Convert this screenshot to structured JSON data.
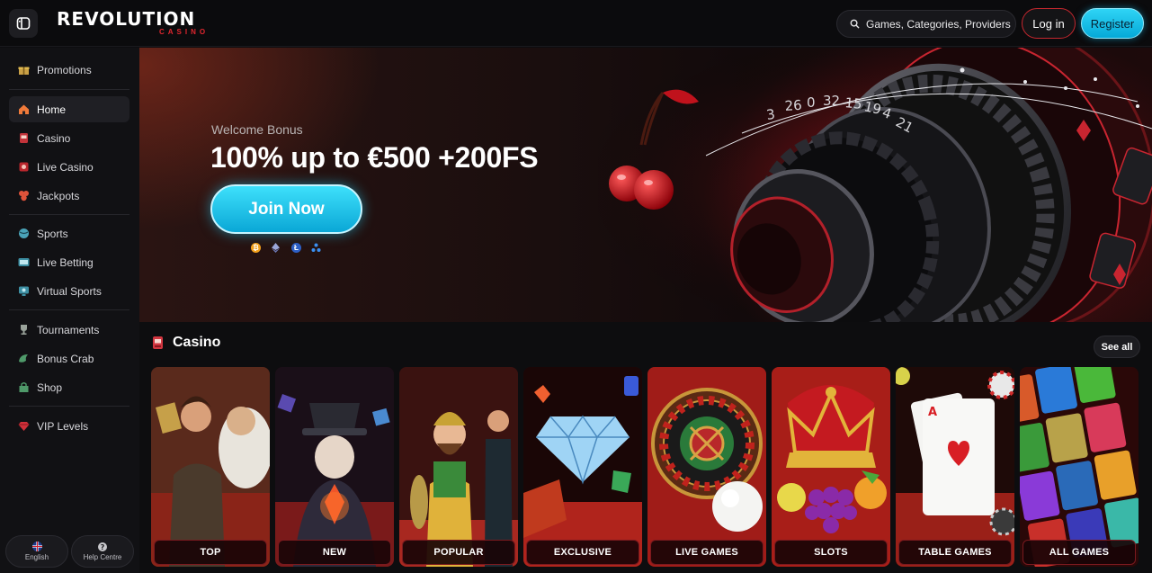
{
  "header": {
    "logo_main": "REVOLUTION",
    "logo_sub": "CASINO",
    "search_placeholder": "Games, Categories, Providers",
    "login_label": "Log in",
    "register_label": "Register"
  },
  "sidebar": {
    "items": [
      {
        "label": "Promotions",
        "icon": "gift-icon"
      },
      {
        "label": "Home",
        "icon": "home-icon"
      },
      {
        "label": "Casino",
        "icon": "slot-machine-icon"
      },
      {
        "label": "Live Casino",
        "icon": "live-casino-icon"
      },
      {
        "label": "Jackpots",
        "icon": "jackpot-icon"
      },
      {
        "label": "Sports",
        "icon": "sports-ball-icon"
      },
      {
        "label": "Live Betting",
        "icon": "live-betting-icon"
      },
      {
        "label": "Virtual Sports",
        "icon": "virtual-sports-icon"
      },
      {
        "label": "Tournaments",
        "icon": "trophy-icon"
      },
      {
        "label": "Bonus Crab",
        "icon": "crab-icon"
      },
      {
        "label": "Shop",
        "icon": "shop-icon"
      },
      {
        "label": "VIP Levels",
        "icon": "diamond-icon"
      }
    ],
    "active": "Home",
    "language_label": "English",
    "help_label": "Help Centre"
  },
  "hero": {
    "bonus_label": "Welcome Bonus",
    "bonus_title": "100% up to €500 +200FS",
    "cta_label": "Join Now",
    "crypto_icons": [
      "bitcoin-icon",
      "ethereum-icon",
      "litecoin-icon",
      "ripple-icon"
    ]
  },
  "casino": {
    "title": "Casino",
    "see_all_label": "See all",
    "categories": [
      "TOP",
      "NEW",
      "POPULAR",
      "EXCLUSIVE",
      "LIVE GAMES",
      "SLOTS",
      "TABLE GAMES",
      "ALL GAMES"
    ]
  },
  "colors": {
    "accent_cyan": "#0aa7d6",
    "brand_red": "#e0262e",
    "background": "#0d0d0f"
  }
}
